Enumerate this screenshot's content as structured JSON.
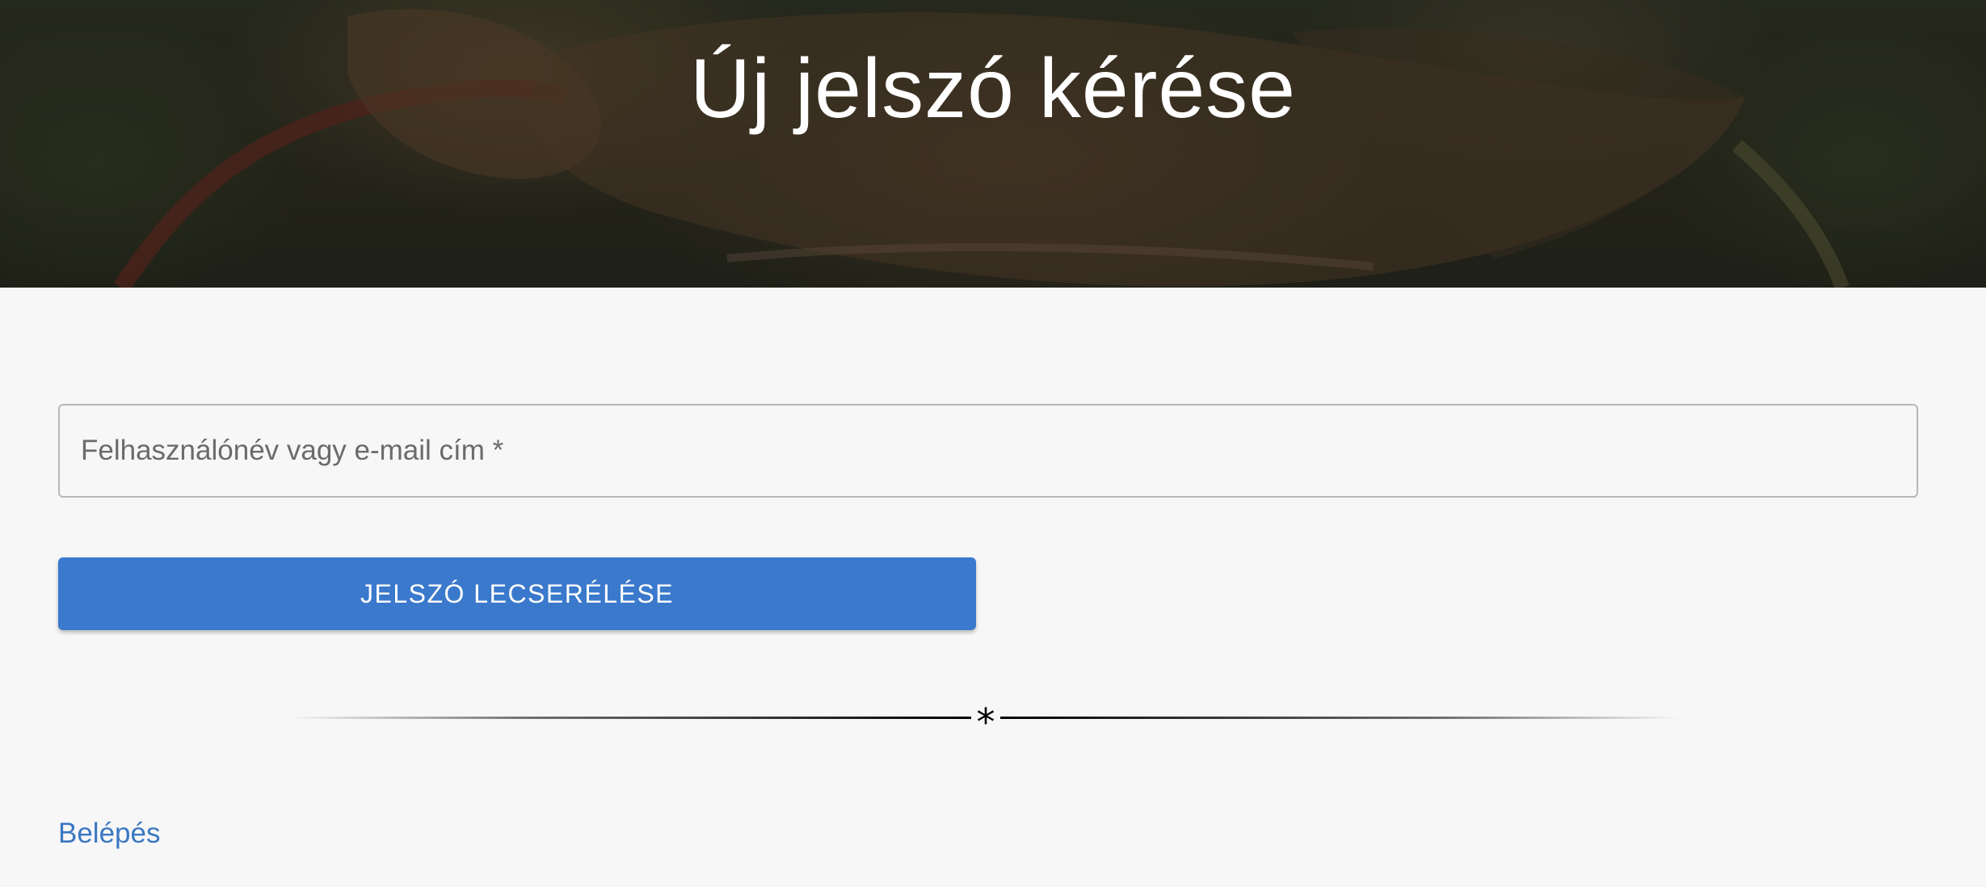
{
  "hero": {
    "title": "Új jelszó kérése"
  },
  "form": {
    "username_placeholder": "Felhasználónév vagy e-mail cím *",
    "username_value": "",
    "submit_label": "JELSZÓ LECSERÉLÉSE"
  },
  "divider": {
    "symbol": "*"
  },
  "links": {
    "login_label": "Belépés"
  },
  "colors": {
    "accent": "#3a79cc",
    "link": "#3b78c2",
    "background": "#f7f7f7"
  }
}
